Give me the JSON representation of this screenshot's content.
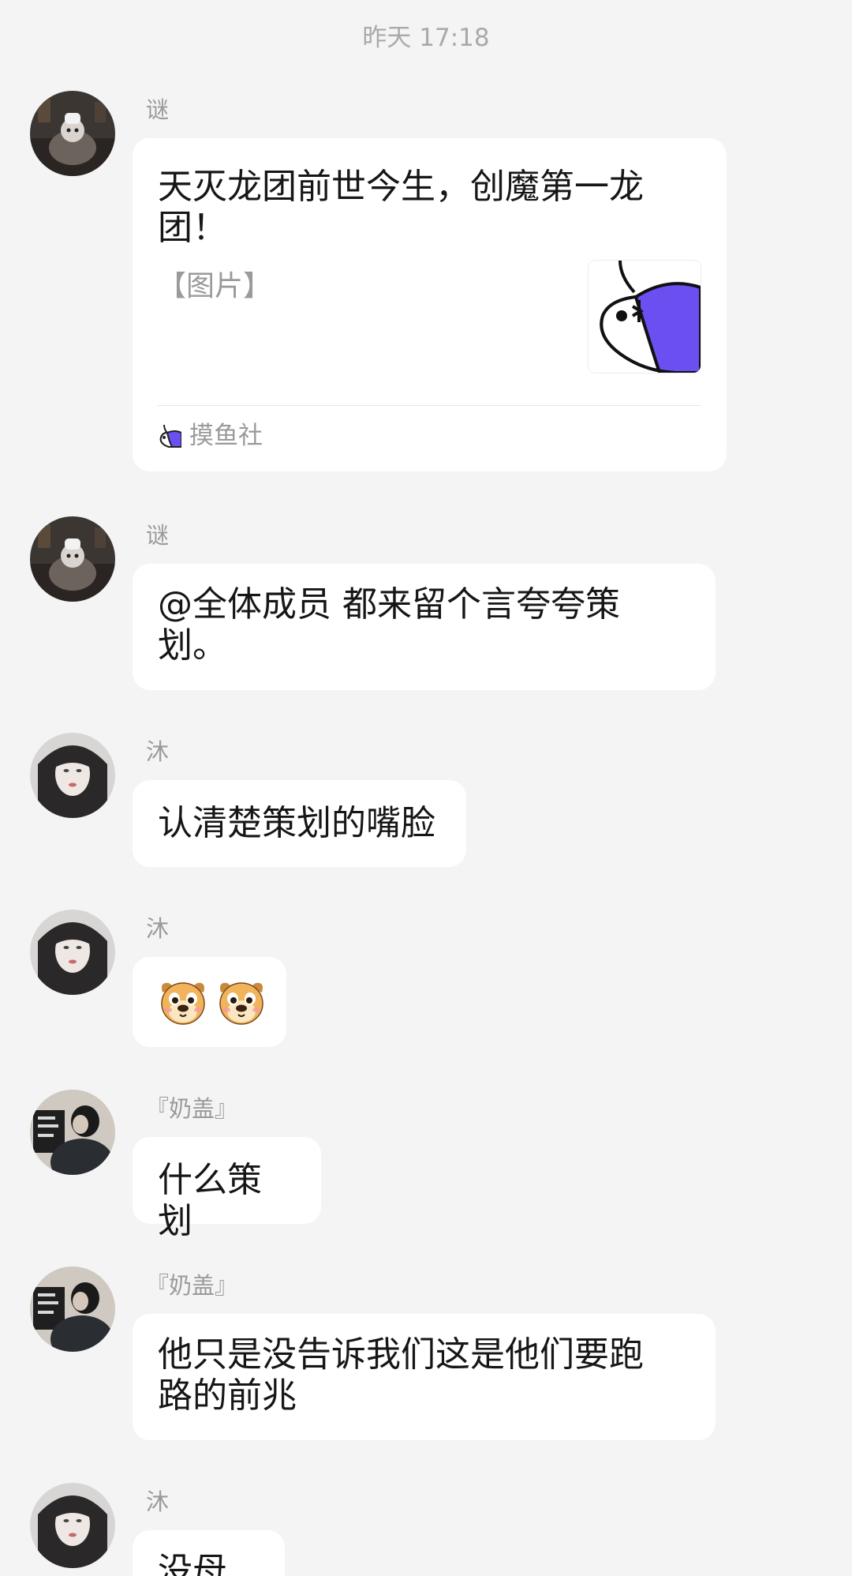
{
  "timestamp": "昨天 17:18",
  "messages": [
    {
      "sender": "谜",
      "card": {
        "title": "天灭龙团前世今生，创魔第一龙团！",
        "desc": "【图片】",
        "source": "摸鱼社",
        "thumb_icon": "fish-logo-icon",
        "source_icon": "fish-logo-icon"
      }
    },
    {
      "sender": "谜",
      "text": "@全体成员 都来留个言夸夸策划。"
    },
    {
      "sender": "沐",
      "text": "认清楚策划的嘴脸"
    },
    {
      "sender": "沐",
      "emojis": [
        "dog-face-emoji-icon",
        "dog-face-emoji-icon"
      ]
    },
    {
      "sender": "『奶盖』",
      "text": "什么策划"
    },
    {
      "sender": "『奶盖』",
      "text": "他只是没告诉我们这是他们要跑路的前兆"
    },
    {
      "sender": "沐",
      "text": "没母的"
    }
  ],
  "colors": {
    "background": "#f4f4f4",
    "bubble": "#ffffff",
    "fish_accent": "#6b4ff0"
  }
}
